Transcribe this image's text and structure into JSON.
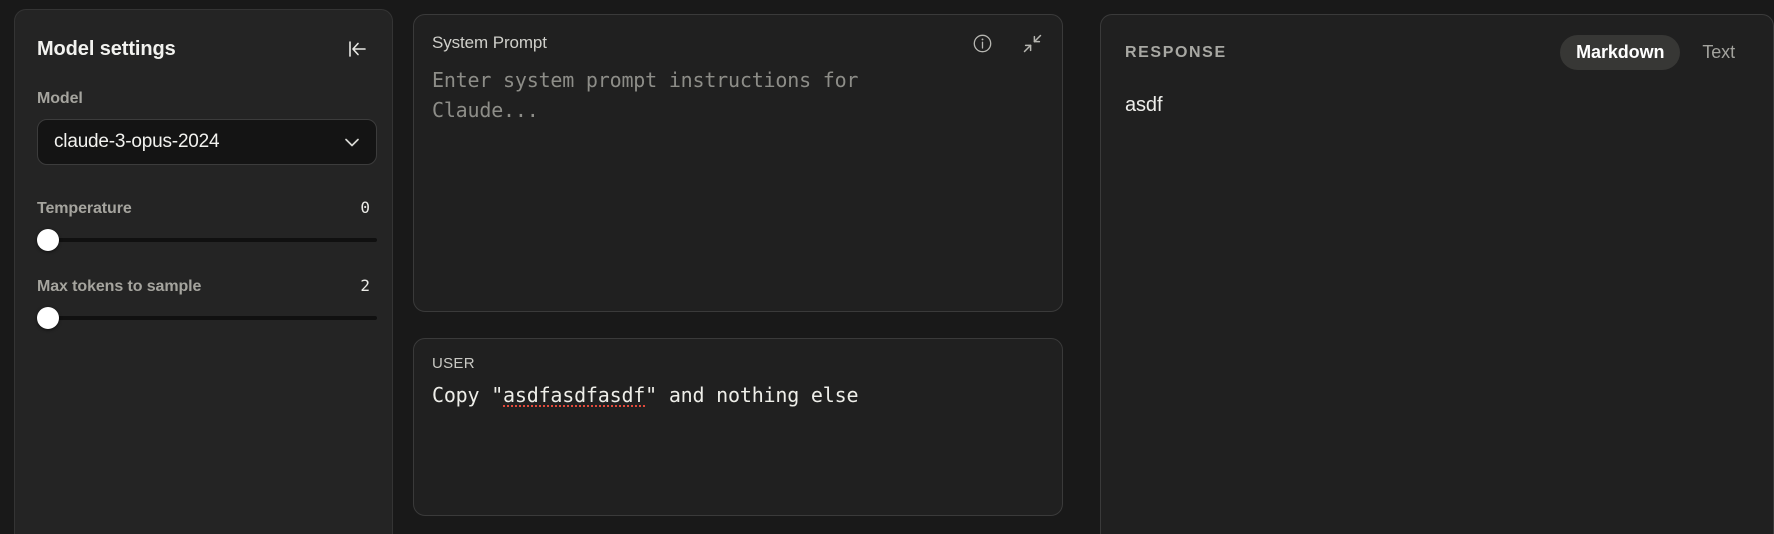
{
  "sidebar": {
    "title": "Model settings",
    "collapse_icon": "collapse-left-icon",
    "model": {
      "label": "Model",
      "value": "claude-3-opus-2024",
      "chevron_icon": "chevron-down-icon"
    },
    "sliders": [
      {
        "label": "Temperature",
        "value": "0",
        "percent": 0
      },
      {
        "label": "Max tokens to sample",
        "value": "2",
        "percent": 0
      }
    ]
  },
  "system_prompt": {
    "label": "System Prompt",
    "placeholder": "Enter system prompt instructions for Claude...",
    "value": "",
    "info_icon": "info-circle-icon",
    "collapse_icon": "minimize-diagonal-icon"
  },
  "user_message": {
    "role_label": "USER",
    "text_before": "Copy \"",
    "text_misspelled": "asdfasdfasdf",
    "text_after": "\" and nothing else"
  },
  "response": {
    "title": "RESPONSE",
    "view_modes": [
      {
        "label": "Markdown",
        "active": true
      },
      {
        "label": "Text",
        "active": false
      }
    ],
    "content": "asdf"
  },
  "colors": {
    "app_background": "#191919",
    "panel_background": "#202020",
    "sidebar_background": "#242424",
    "panel_border": "#3a3a3a",
    "input_background": "#141414",
    "text_primary": "#f2f2ef",
    "text_muted": "#a5a49e",
    "accent_pill": "#373735",
    "spellcheck_underline": "#e04a3c",
    "slider_thumb": "#ffffff"
  }
}
